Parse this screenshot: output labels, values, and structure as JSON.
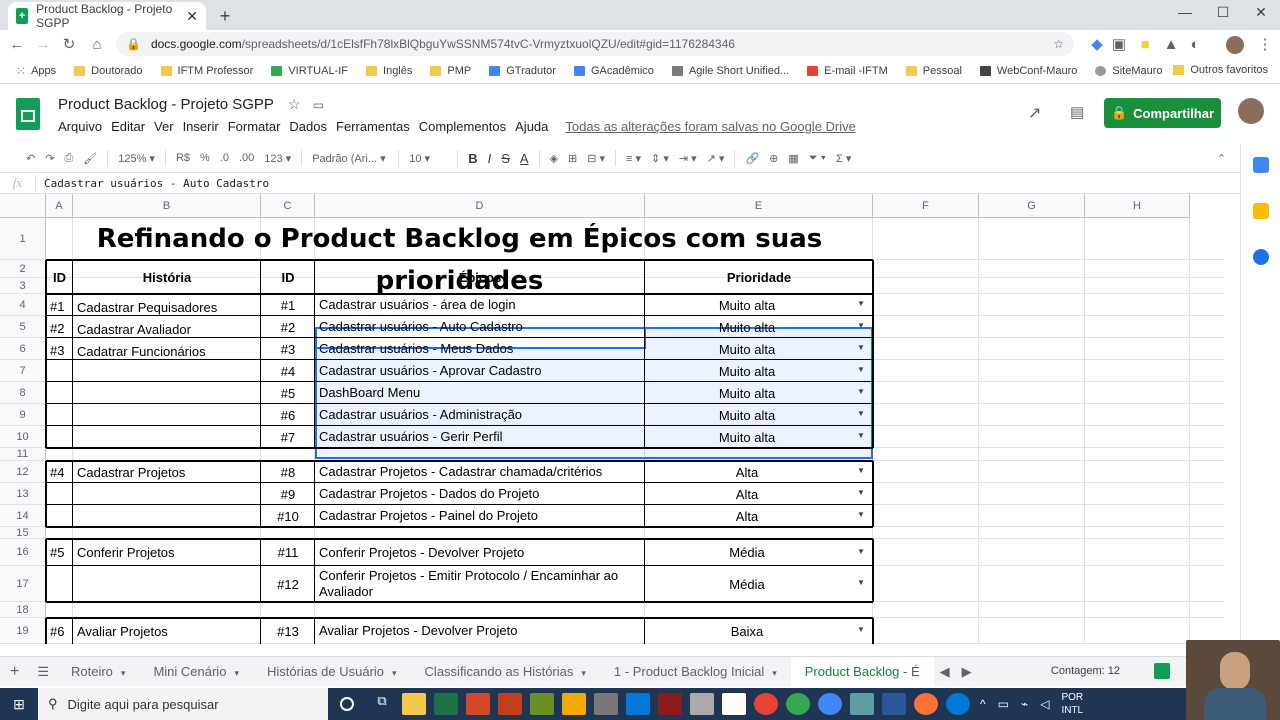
{
  "browser": {
    "tab_title": "Product Backlog - Projeto SGPP",
    "url_host": "docs.google.com",
    "url_path": "/spreadsheets/d/1cElsfFh78lxBlQbguYwSSNM574tvC-VrmyztxuolQZU/edit#gid=1176284346",
    "bookmarks": [
      "Apps",
      "Doutorado",
      "IFTM Professor",
      "VIRTUAL-IF",
      "Inglês",
      "PMP",
      "GTradutor",
      "GAcadêmico",
      "Agile Short Unified...",
      "E-mail -IFTM",
      "Pessoal",
      "WebConf-Mauro",
      "SiteMauro"
    ],
    "bookmarks_other": "Outros favoritos"
  },
  "doc": {
    "title": "Product Backlog - Projeto SGPP",
    "menus": [
      "Arquivo",
      "Editar",
      "Ver",
      "Inserir",
      "Formatar",
      "Dados",
      "Ferramentas",
      "Complementos",
      "Ajuda"
    ],
    "save_status": "Todas as alterações foram salvas no Google Drive",
    "share_label": "Compartilhar"
  },
  "toolbar": {
    "zoom": "125%",
    "currency": "R$",
    "percent": "%",
    "dec_less": ".0",
    "dec_more": ".00",
    "format_more": "123",
    "font": "Padrão (Ari...",
    "font_size": "10"
  },
  "formula_bar": {
    "fx": "fx",
    "content": "Cadastrar usuários - Auto Cadastro"
  },
  "columns": [
    "A",
    "B",
    "C",
    "D",
    "E",
    "F",
    "G",
    "H"
  ],
  "rows": [
    "1",
    "2",
    "3",
    "4",
    "5",
    "6",
    "7",
    "8",
    "9",
    "10",
    "11",
    "12",
    "13",
    "14",
    "15",
    "16",
    "17",
    "18",
    "19"
  ],
  "sheet": {
    "title": "Refinando o Product Backlog em Épicos com suas prioridades",
    "headers": {
      "id1": "ID",
      "historia": "História",
      "id2": "ID",
      "epicos": "Épicos",
      "prioridade": "Prioridade"
    },
    "historias": [
      {
        "id": "#1",
        "name": "Cadastrar Pequisadores"
      },
      {
        "id": "#2",
        "name": "Cadastrar Avaliador"
      },
      {
        "id": "#3",
        "name": "Cadatrar Funcionários"
      },
      {
        "id": "#4",
        "name": "Cadastrar Projetos"
      },
      {
        "id": "#5",
        "name": "Conferir Projetos"
      },
      {
        "id": "#6",
        "name": "Avaliar Projetos"
      }
    ],
    "epicos": [
      {
        "id": "#1",
        "name": "Cadastrar usuários - área de login",
        "prio": "Muito alta"
      },
      {
        "id": "#2",
        "name": "Cadastrar usuários - Auto Cadastro",
        "prio": "Muito alta"
      },
      {
        "id": "#3",
        "name": "Cadastrar usuários - Meus Dados",
        "prio": "Muito alta"
      },
      {
        "id": "#4",
        "name": "Cadastrar usuários - Aprovar Cadastro",
        "prio": "Muito alta"
      },
      {
        "id": "#5",
        "name": "DashBoard Menu",
        "prio": "Muito alta"
      },
      {
        "id": "#6",
        "name": "Cadastrar usuários - Administração",
        "prio": "Muito alta"
      },
      {
        "id": "#7",
        "name": "Cadastrar usuários - Gerir Perfil",
        "prio": "Muito alta"
      },
      {
        "id": "#8",
        "name": "Cadastrar Projetos - Cadastrar chamada/critérios",
        "prio": "Alta"
      },
      {
        "id": "#9",
        "name": "Cadastrar Projetos - Dados do Projeto",
        "prio": "Alta"
      },
      {
        "id": "#10",
        "name": "Cadastrar Projetos - Painel do Projeto",
        "prio": "Alta"
      },
      {
        "id": "#11",
        "name": "Conferir Projetos - Devolver Projeto",
        "prio": "Média"
      },
      {
        "id": "#12",
        "name": "Conferir Projetos - Emitir Protocolo / Encaminhar ao",
        "name2": "Avaliador",
        "prio": "Média"
      },
      {
        "id": "#13",
        "name": "Avaliar Projetos - Devolver Projeto",
        "prio": "Baixa"
      }
    ]
  },
  "sheet_tabs": [
    "Roteiro",
    "Mini Cenário",
    "Histórias de Usuário",
    "Classificando as Histórias",
    "1 - Product Backlog Inicial",
    "Product Backlog - É"
  ],
  "contagem": "Contagem: 12",
  "taskbar": {
    "search_placeholder": "Digite aqui para pesquisar",
    "lang": "POR",
    "layout": "INTL"
  },
  "colors": {
    "share_green": "#1a8f3c",
    "selection_blue": "#1a73e8",
    "sheets_green": "#0f9d58",
    "taskbar": "#1e3553"
  }
}
